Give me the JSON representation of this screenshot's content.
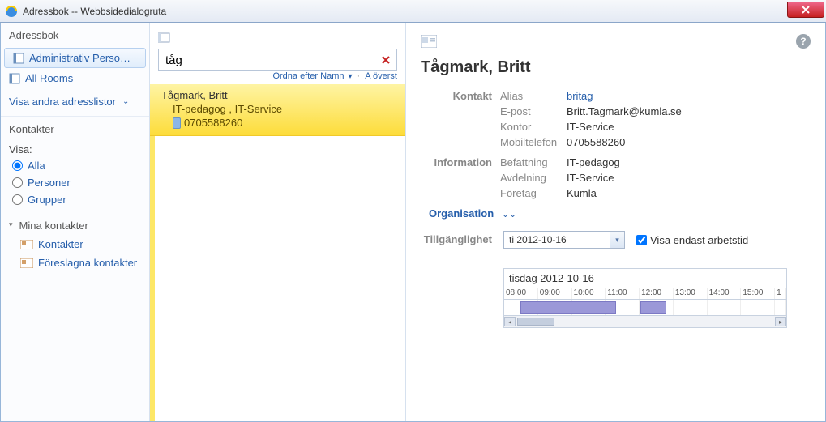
{
  "window": {
    "title": "Adressbok -- Webbsidedialogruta"
  },
  "left": {
    "header": "Adressbok",
    "lists": {
      "admin": "Administrativ Perso…",
      "rooms": "All Rooms",
      "other": "Visa andra adresslistor"
    },
    "contacts_hdr": "Kontakter",
    "visa_label": "Visa:",
    "radios": {
      "all": "Alla",
      "people": "Personer",
      "groups": "Grupper"
    },
    "mine_hdr": "Mina kontakter",
    "mine_items": {
      "contacts": "Kontakter",
      "suggested": "Föreslagna kontakter"
    }
  },
  "search": {
    "value": "tåg",
    "sort_label": "Ordna efter Namn",
    "sort_dir": "A överst"
  },
  "result": {
    "name": "Tågmark, Britt",
    "sub": "IT-pedagog , IT-Service",
    "phone": "0705588260"
  },
  "details": {
    "title": "Tågmark, Britt",
    "sec_contact": "Kontakt",
    "sec_info": "Information",
    "labels": {
      "alias": "Alias",
      "email": "E-post",
      "office": "Kontor",
      "mobile": "Mobiltelefon",
      "jobtitle": "Befattning",
      "dept": "Avdelning",
      "company": "Företag"
    },
    "values": {
      "alias": "britag",
      "email": "Britt.Tagmark@kumla.se",
      "office": "IT-Service",
      "mobile": "0705588260",
      "jobtitle": "IT-pedagog",
      "dept": "IT-Service",
      "company": "Kumla"
    },
    "org": "Organisation",
    "availability_label": "Tillgänglighet",
    "date_value": "ti 2012-10-16",
    "show_work": "Visa endast arbetstid",
    "sched_day": "tisdag 2012-10-16",
    "hours": [
      "08:00",
      "09:00",
      "10:00",
      "11:00",
      "12:00",
      "13:00",
      "14:00",
      "15:00",
      "1"
    ]
  }
}
